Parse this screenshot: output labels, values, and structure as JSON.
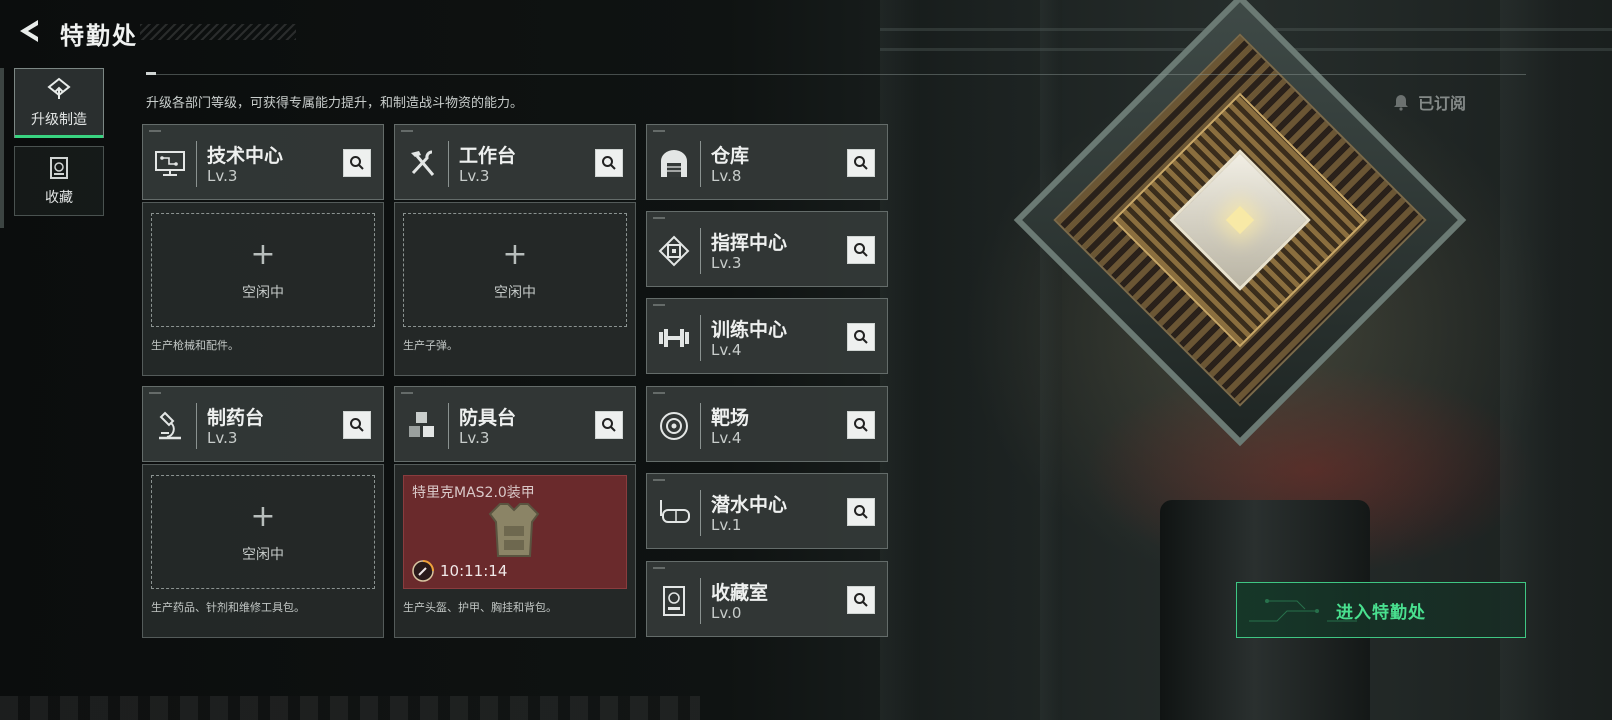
{
  "header": {
    "title": "特勤处"
  },
  "nav": {
    "tabs": [
      {
        "label": "升级制造",
        "icon": "upgrade-icon",
        "active": true
      },
      {
        "label": "收藏",
        "icon": "collection-icon",
        "active": false
      }
    ]
  },
  "description": "升级各部门等级，可获得专属能力提升，和制造战斗物资的能力。",
  "facilities": {
    "tech_center": {
      "name": "技术中心",
      "level": "Lv.3",
      "icon": "monitor-circuit-icon"
    },
    "workbench": {
      "name": "工作台",
      "level": "Lv.3",
      "icon": "hammer-wrench-icon"
    },
    "pharmacy": {
      "name": "制药台",
      "level": "Lv.3",
      "icon": "microscope-icon"
    },
    "armor_bench": {
      "name": "防具台",
      "level": "Lv.3",
      "icon": "cubes-icon"
    },
    "warehouse": {
      "name": "仓库",
      "level": "Lv.8",
      "icon": "warehouse-icon"
    },
    "command_center": {
      "name": "指挥中心",
      "level": "Lv.3",
      "icon": "chip-icon"
    },
    "training_center": {
      "name": "训练中心",
      "level": "Lv.4",
      "icon": "dumbbell-icon"
    },
    "range": {
      "name": "靶场",
      "level": "Lv.4",
      "icon": "target-icon"
    },
    "diving_center": {
      "name": "潜水中心",
      "level": "Lv.1",
      "icon": "diving-mask-icon"
    },
    "collection_room": {
      "name": "收藏室",
      "level": "Lv.0",
      "icon": "display-case-icon"
    }
  },
  "production": {
    "tech_center": {
      "state": "空闲中",
      "desc": "生产枪械和配件。"
    },
    "workbench": {
      "state": "空闲中",
      "desc": "生产子弹。"
    },
    "pharmacy": {
      "state": "空闲中",
      "desc": "生产药品、针剂和维修工具包。"
    },
    "armor_bench": {
      "item": "特里克MAS2.0装甲",
      "timer": "10:11:14",
      "desc": "生产头盔、护甲、胸挂和背包。"
    }
  },
  "right": {
    "subscribed": "已订阅",
    "enter_button": "进入特勤处"
  },
  "colors": {
    "accent_green": "#39d481",
    "progress_red": "#6a2a2c"
  }
}
